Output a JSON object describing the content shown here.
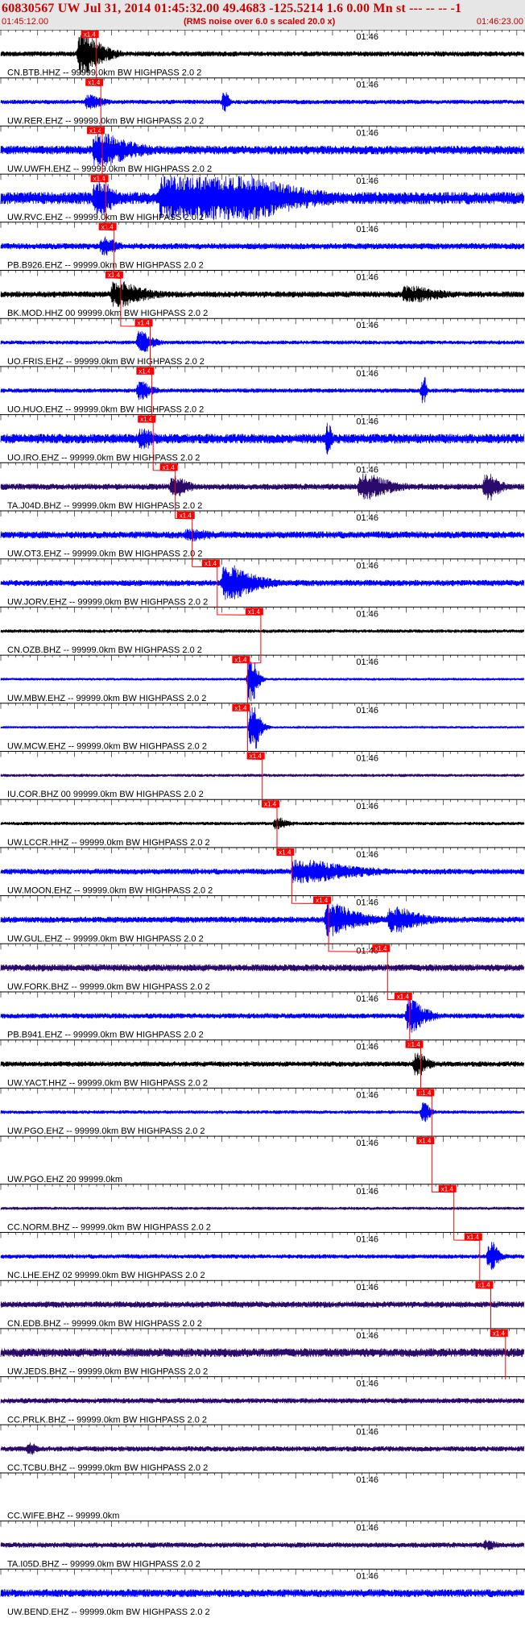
{
  "header": {
    "title": "60830567 UW Jul 31, 2014 01:45:32.00   49.4683 -125.5214  1.6 0.00 Mn st --- -- --  -1",
    "start_time": "01:45:12.00",
    "subtitle": "(RMS noise over 6.0 s scaled 20.0 x)",
    "end_time": "01:46:23.00"
  },
  "colors": {
    "trace_blue": "#0000ff",
    "trace_black": "#000000",
    "trace_purple": "#2a0a6a",
    "pick_red": "#ff0000",
    "header_bg": "#e6e6e6",
    "header_text": "#cc0000"
  },
  "chart_data": {
    "type": "line",
    "title": "60830567 UW Jul 31, 2014 01:45:32.00   49.4683 -125.5214  1.6 0.00 Mn st --- -- --  -1",
    "time_start_s": 0,
    "time_end_s": 71,
    "time_marker_label": "01:46",
    "time_marker_s": 48,
    "pick_label": "x1.4",
    "series": [
      {
        "name": "CN.BTB.HHZ -- 99999.0km BW  HIGHPASS  2.0  2",
        "color": "#000000",
        "pick_s": 11.0,
        "amp": 0.12,
        "bursts": [
          [
            11.0,
            2.5,
            1.0,
            1.0
          ]
        ]
      },
      {
        "name": "UW.RER.EHZ -- 99999.0km BW  HIGHPASS  2.0  2",
        "color": "#0000ff",
        "pick_s": 11.6,
        "amp": 0.1,
        "bursts": [
          [
            12.0,
            2.0,
            0.35,
            1.0
          ],
          [
            30.5,
            0.8,
            0.45,
            0.5
          ]
        ]
      },
      {
        "name": "UW.UWFH.EHZ -- 99999.0km BW  HIGHPASS  2.0  2",
        "color": "#0000ff",
        "pick_s": 11.8,
        "amp": 0.2,
        "bursts": [
          [
            13.0,
            5.0,
            0.75,
            1.0
          ]
        ]
      },
      {
        "name": "UW.RVC.EHZ -- 99999.0km BW  HIGHPASS  2.0  2",
        "color": "#0000ff",
        "pick_s": 12.3,
        "amp": 0.28,
        "bursts": [
          [
            13.0,
            4.0,
            0.8,
            0.5
          ],
          [
            22.0,
            43.0,
            1.0,
            0.2
          ]
        ]
      },
      {
        "name": "PB.B926.EHZ -- 99999.0km BW  HIGHPASS  2.0  2",
        "color": "#0000ff",
        "pick_s": 13.4,
        "amp": 0.14,
        "bursts": [
          [
            14.0,
            2.0,
            0.45,
            1.0
          ]
        ]
      },
      {
        "name": "BK.MOD.HHZ 00 99999.0km BW  HIGHPASS  2.0  2",
        "color": "#000000",
        "pick_s": 14.3,
        "amp": 0.14,
        "bursts": [
          [
            15.5,
            4.0,
            0.6,
            1.0
          ],
          [
            55.0,
            5.0,
            0.4,
            1.0
          ]
        ]
      },
      {
        "name": "UO.FRIS.EHZ -- 99999.0km BW  HIGHPASS  2.0  2",
        "color": "#0000ff",
        "pick_s": 18.3,
        "amp": 0.09,
        "bursts": [
          [
            19.0,
            1.5,
            0.55,
            1.0
          ]
        ]
      },
      {
        "name": "UO.HUO.EHZ -- 99999.0km BW  HIGHPASS  2.0  2",
        "color": "#0000ff",
        "pick_s": 18.5,
        "amp": 0.1,
        "bursts": [
          [
            19.0,
            1.5,
            0.45,
            1.0
          ],
          [
            57.5,
            0.5,
            0.6,
            0.5
          ]
        ]
      },
      {
        "name": "UO.IRO.EHZ -- 99999.0km BW  HIGHPASS  2.0  2",
        "color": "#0000ff",
        "pick_s": 18.7,
        "amp": 0.22,
        "bursts": [
          [
            19.2,
            2.0,
            0.5,
            1.0
          ],
          [
            44.6,
            0.5,
            0.8,
            0.5
          ]
        ]
      },
      {
        "name": "TA.J04D.BHZ -- 99999.0km BW  HIGHPASS  2.0  2",
        "color": "#2a0a6a",
        "pick_s": 21.7,
        "amp": 0.14,
        "bursts": [
          [
            23.5,
            2.0,
            0.5,
            1.0
          ],
          [
            49.0,
            4.0,
            0.6,
            1.0
          ],
          [
            66.0,
            1.5,
            0.7,
            1.0
          ]
        ]
      },
      {
        "name": "UW.OT3.EHZ -- 99999.0km BW  HIGHPASS  2.0  2",
        "color": "#0000ff",
        "pick_s": 24.0,
        "amp": 0.16,
        "bursts": [
          [
            25.5,
            4.0,
            0.3,
            1.0
          ]
        ]
      },
      {
        "name": "UW.JORV.EHZ -- 99999.0km BW  HIGHPASS  2.0  2",
        "color": "#0000ff",
        "pick_s": 27.4,
        "amp": 0.14,
        "bursts": [
          [
            30.5,
            4.0,
            0.8,
            1.0
          ]
        ]
      },
      {
        "name": "CN.OZB.BHZ -- 99999.0km BW  HIGHPASS  2.0  2",
        "color": "#000000",
        "pick_s": 33.3,
        "amp": 0.08,
        "bursts": []
      },
      {
        "name": "UW.MBW.EHZ -- 99999.0km BW  HIGHPASS  2.0  2",
        "color": "#0000ff",
        "pick_s": 31.5,
        "amp": 0.06,
        "bursts": [
          [
            34.0,
            1.3,
            1.0,
            0.5
          ]
        ]
      },
      {
        "name": "UW.MCW.EHZ -- 99999.0km BW  HIGHPASS  2.0  2",
        "color": "#0000ff",
        "pick_s": 31.5,
        "amp": 0.05,
        "bursts": [
          [
            34.2,
            1.5,
            1.0,
            0.5
          ]
        ]
      },
      {
        "name": "IU.COR.BHZ 00 99999.0km BW  HIGHPASS  2.0  2",
        "color": "#2a0a6a",
        "pick_s": 33.5,
        "amp": 0.07,
        "bursts": []
      },
      {
        "name": "UW.LCCR.HHZ -- 99999.0km BW  HIGHPASS  2.0  2",
        "color": "#000000",
        "pick_s": 35.5,
        "amp": 0.08,
        "bursts": [
          [
            37.5,
            1.5,
            0.3,
            1.0
          ]
        ]
      },
      {
        "name": "UW.MOON.EHZ -- 99999.0km BW  HIGHPASS  2.0  2",
        "color": "#0000ff",
        "pick_s": 37.5,
        "amp": 0.13,
        "bursts": [
          [
            40.0,
            8.0,
            0.55,
            1.0
          ]
        ]
      },
      {
        "name": "UW.GUL.EHZ -- 99999.0km BW  HIGHPASS  2.0  2",
        "color": "#0000ff",
        "pick_s": 42.5,
        "amp": 0.14,
        "bursts": [
          [
            44.5,
            4.0,
            0.75,
            1.0
          ],
          [
            53.0,
            4.0,
            0.6,
            1.0
          ]
        ]
      },
      {
        "name": "UW.FORK.BHZ -- 99999.0km BW  HIGHPASS  2.0  2",
        "color": "#2a0a6a",
        "pick_s": 50.5,
        "amp": 0.16,
        "bursts": []
      },
      {
        "name": "PB.B941.EHZ -- 99999.0km BW  HIGHPASS  2.0  2",
        "color": "#0000ff",
        "pick_s": 53.5,
        "amp": 0.12,
        "bursts": [
          [
            55.5,
            2.0,
            0.8,
            1.0
          ]
        ]
      },
      {
        "name": "UW.YACT.HHZ -- 99999.0km BW  HIGHPASS  2.0  2",
        "color": "#000000",
        "pick_s": 55.0,
        "amp": 0.12,
        "bursts": [
          [
            56.5,
            1.5,
            0.55,
            1.0
          ]
        ]
      },
      {
        "name": "UW.PGO.EHZ -- 99999.0km BW  HIGHPASS  2.0  2",
        "color": "#0000ff",
        "pick_s": 56.5,
        "amp": 0.08,
        "bursts": [
          [
            57.5,
            0.8,
            0.45,
            1.0
          ]
        ]
      },
      {
        "name": "UW.PGO.EHZ 20 99999.0km",
        "color": "#0000ff",
        "pick_s": 56.5,
        "amp": 0.0,
        "bursts": []
      },
      {
        "name": "CC.NORM.BHZ -- 99999.0km BW  HIGHPASS  2.0  2",
        "color": "#2a0a6a",
        "pick_s": 59.5,
        "amp": 0.07,
        "bursts": []
      },
      {
        "name": "NC.LHE.EHZ 02 99999.0km BW  HIGHPASS  2.0  2",
        "color": "#0000ff",
        "pick_s": 63.0,
        "amp": 0.1,
        "bursts": [
          [
            66.5,
            1.0,
            0.7,
            1.0
          ]
        ]
      },
      {
        "name": "CN.EDB.BHZ -- 99999.0km BW  HIGHPASS  2.0  2",
        "color": "#2a0a6a",
        "pick_s": 64.5,
        "amp": 0.14,
        "bursts": []
      },
      {
        "name": "UW.JEDS.BHZ -- 99999.0km BW  HIGHPASS  2.0  2",
        "color": "#2a0a6a",
        "pick_s": 66.5,
        "amp": 0.2,
        "bursts": []
      },
      {
        "name": "CC.PRLK.BHZ -- 99999.0km BW  HIGHPASS  2.0  2",
        "color": "#2a0a6a",
        "pick_s": null,
        "amp": 0.12,
        "bursts": []
      },
      {
        "name": "CC.TCBU.BHZ -- 99999.0km BW  HIGHPASS  2.0  2",
        "color": "#2a0a6a",
        "pick_s": null,
        "amp": 0.12,
        "bursts": [
          [
            4.0,
            1.0,
            0.3,
            1.0
          ]
        ]
      },
      {
        "name": "CC.WIFE.BHZ -- 99999.0km",
        "color": "#2a0a6a",
        "pick_s": null,
        "amp": 0.0,
        "bursts": []
      },
      {
        "name": "TA.I05D.BHZ -- 99999.0km BW  HIGHPASS  2.0  2",
        "color": "#2a0a6a",
        "pick_s": null,
        "amp": 0.12,
        "bursts": [
          [
            66.0,
            1.5,
            0.25,
            1.0
          ]
        ]
      },
      {
        "name": "UW.BEND.EHZ -- 99999.0km BW  HIGHPASS  2.0  2",
        "color": "#0000ff",
        "pick_s": null,
        "amp": 0.18,
        "bursts": []
      }
    ]
  }
}
